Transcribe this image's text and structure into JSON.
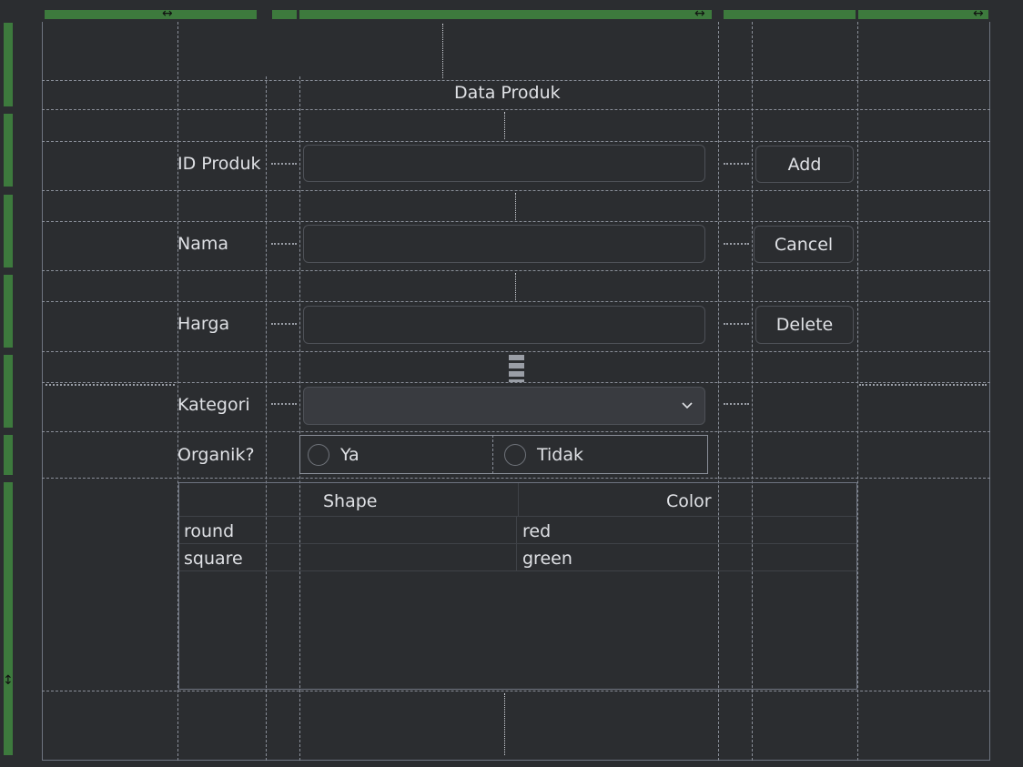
{
  "form": {
    "title": "Data Produk",
    "labels": {
      "id_produk": "ID Produk",
      "nama": "Nama",
      "harga": "Harga",
      "kategori": "Kategori",
      "organik": "Organik?"
    },
    "fields": {
      "id_produk_value": "",
      "nama_value": "",
      "harga_value": "",
      "kategori_selected": ""
    },
    "buttons": {
      "add": "Add",
      "cancel": "Cancel",
      "delete": "Delete"
    },
    "radios": {
      "ya": "Ya",
      "tidak": "Tidak"
    }
  },
  "table": {
    "columns": [
      "Shape",
      "Color"
    ],
    "rows": [
      [
        "round",
        "red"
      ],
      [
        "square",
        "green"
      ]
    ]
  },
  "designer": {
    "spacer_glyph": "ꗱ",
    "resize_h": "↔",
    "resize_v": "↕"
  }
}
